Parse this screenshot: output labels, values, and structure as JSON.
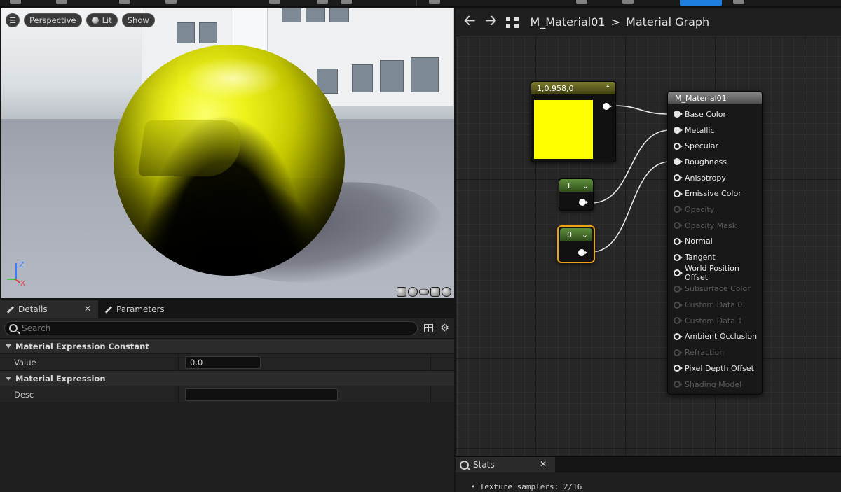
{
  "viewport": {
    "menu_icon": "hamburger-icon",
    "view_mode": "Perspective",
    "lighting": "Lit",
    "show": "Show",
    "axis_z": "Z",
    "axis_x": "X",
    "preview_shapes": [
      "cylinder-icon",
      "sphere-icon",
      "plane-icon",
      "cube-icon",
      "teapot-icon"
    ]
  },
  "details": {
    "tabs": [
      {
        "label": "Details",
        "icon": "pencil-icon"
      },
      {
        "label": "Parameters",
        "icon": "pencil-icon"
      }
    ],
    "search_placeholder": "Search",
    "sections": [
      {
        "title": "Material Expression Constant",
        "props": [
          {
            "name": "Value",
            "value": "0.0"
          }
        ]
      },
      {
        "title": "Material Expression",
        "props": [
          {
            "name": "Desc",
            "value": ""
          }
        ]
      }
    ]
  },
  "graph": {
    "breadcrumb_root": "M_Material01",
    "breadcrumb_sep": ">",
    "breadcrumb_leaf": "Material Graph",
    "color_node": {
      "title": "1,0.958,0",
      "color": "#ffff00"
    },
    "const_nodes": [
      {
        "title": "1",
        "selected": false
      },
      {
        "title": "0",
        "selected": true
      }
    ],
    "material_node": {
      "title": "M_Material01",
      "pins": [
        {
          "label": "Base Color",
          "state": "connected"
        },
        {
          "label": "Metallic",
          "state": "connected"
        },
        {
          "label": "Specular",
          "state": "enabled"
        },
        {
          "label": "Roughness",
          "state": "connected"
        },
        {
          "label": "Anisotropy",
          "state": "enabled"
        },
        {
          "label": "Emissive Color",
          "state": "enabled"
        },
        {
          "label": "Opacity",
          "state": "disabled"
        },
        {
          "label": "Opacity Mask",
          "state": "disabled"
        },
        {
          "label": "Normal",
          "state": "enabled"
        },
        {
          "label": "Tangent",
          "state": "enabled"
        },
        {
          "label": "World Position Offset",
          "state": "enabled"
        },
        {
          "label": "Subsurface Color",
          "state": "disabled"
        },
        {
          "label": "Custom Data 0",
          "state": "disabled"
        },
        {
          "label": "Custom Data 1",
          "state": "disabled"
        },
        {
          "label": "Ambient Occlusion",
          "state": "enabled"
        },
        {
          "label": "Refraction",
          "state": "disabled"
        },
        {
          "label": "Pixel Depth Offset",
          "state": "enabled"
        },
        {
          "label": "Shading Model",
          "state": "disabled"
        }
      ]
    }
  },
  "stats": {
    "tab_label": "Stats",
    "lines": [
      "Texture samplers: 2/16"
    ]
  },
  "colors": {
    "accent": "#2e7cf6",
    "selection": "#e8a317",
    "constant_header": "#4d7a32"
  }
}
